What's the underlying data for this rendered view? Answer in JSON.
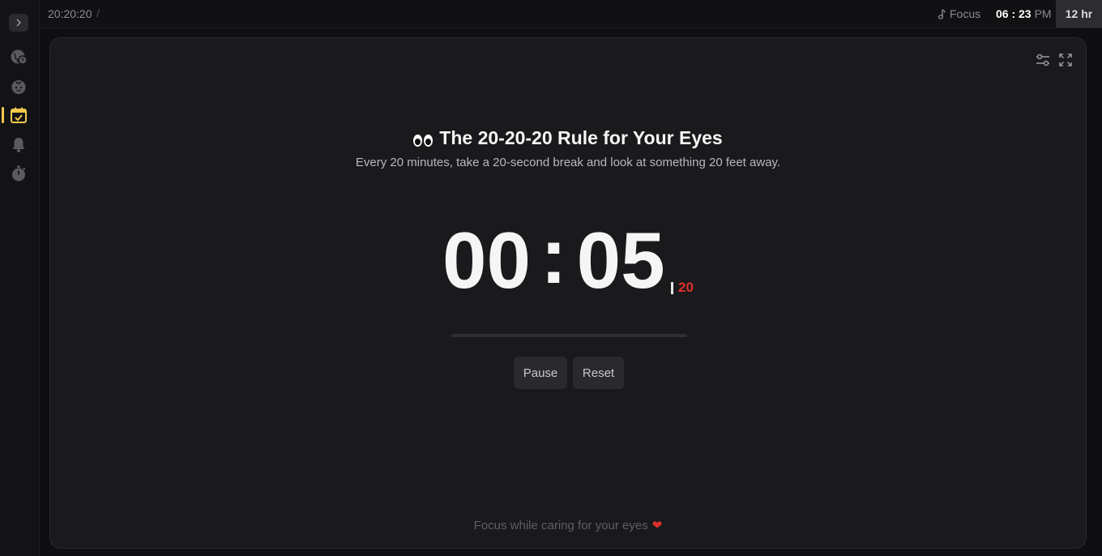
{
  "breadcrumb": {
    "current": "20:20:20",
    "separator": "/"
  },
  "header": {
    "focus_label": "Focus",
    "clock_time": "06 : 23",
    "clock_period": "PM",
    "format_toggle": "12 hr"
  },
  "sidebar": {
    "items": [
      {
        "icon": "globe-clock-icon"
      },
      {
        "icon": "tomato-icon"
      },
      {
        "icon": "calendar-check-icon",
        "active": true
      },
      {
        "icon": "bell-icon"
      },
      {
        "icon": "stopwatch-icon"
      }
    ],
    "accent_color": "#f2c94c"
  },
  "main": {
    "title": "The 20-20-20 Rule for Your Eyes",
    "subtitle": "Every 20 minutes, take a 20-second break and look at something 20 feet away.",
    "timer_minutes": "00",
    "timer_separator": ":",
    "timer_seconds": "05",
    "timer_total": "20",
    "progress_fraction": 0,
    "pause_label": "Pause",
    "reset_label": "Reset",
    "footer_text": "Focus while caring for your eyes",
    "footer_emoji": "❤"
  },
  "colors": {
    "background": "#0f0f11",
    "card": "#1a1a1d",
    "accent_red": "#e0302b"
  }
}
